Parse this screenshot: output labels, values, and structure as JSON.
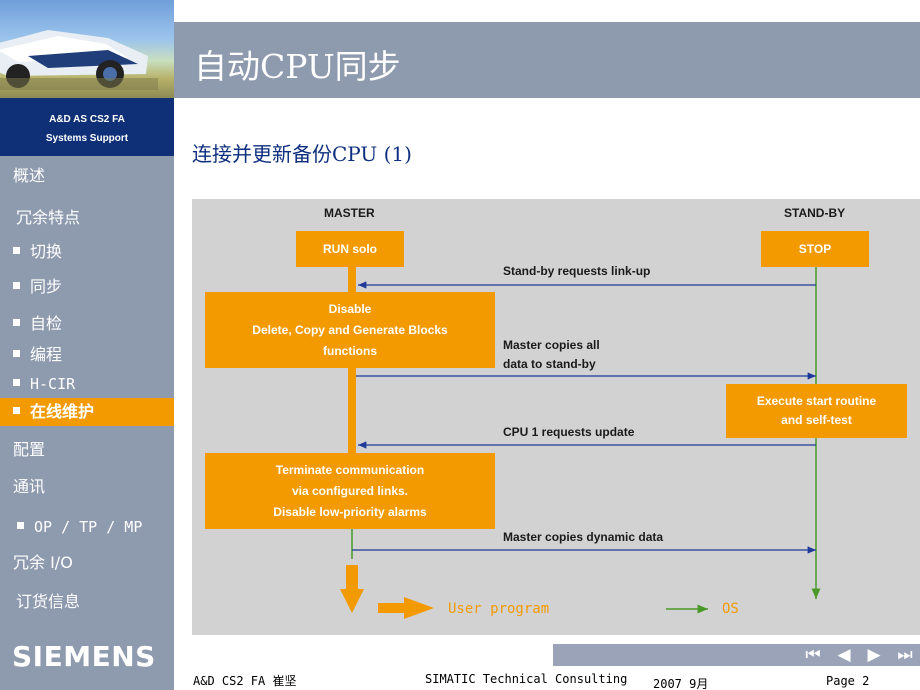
{
  "sidebar": {
    "brand_line1": "A&D AS CS2 FA",
    "brand_line2": "Systems Support",
    "items": [
      {
        "label": "概述"
      },
      {
        "label": "冗余特点"
      },
      {
        "label": "切换"
      },
      {
        "label": "同步"
      },
      {
        "label": "自检"
      },
      {
        "label": "编程"
      },
      {
        "label": "H-CIR"
      },
      {
        "label": "在线维护"
      },
      {
        "label": "配置"
      },
      {
        "label": "通讯"
      },
      {
        "label": "OP / TP / MP"
      },
      {
        "label": "冗余 I/O"
      },
      {
        "label": "订货信息"
      }
    ],
    "logo": "SIEMENS"
  },
  "header": {
    "title": "自动CPU同步",
    "subtitle": "连接并更新备份CPU (1)"
  },
  "diagram": {
    "master_label": "MASTER",
    "standby_label": "STAND-BY",
    "run_solo": "RUN solo",
    "stop": "STOP",
    "msg_linkup": "Stand-by requests link-up",
    "box_disable": [
      "Disable",
      "Delete, Copy and Generate Blocks",
      "functions"
    ],
    "msg_copies_all": [
      "Master copies all",
      "data to stand-by"
    ],
    "box_execute": [
      "Execute start routine",
      "and self-test"
    ],
    "msg_cpu1": "CPU 1 requests update",
    "box_terminate": [
      "Terminate communication",
      "via configured links.",
      "Disable low-priority alarms"
    ],
    "msg_dynamic": "Master copies dynamic data",
    "legend_user": "User program",
    "legend_os": "OS"
  },
  "footer": {
    "left": "A&D CS2  FA  崔坚",
    "center": "SIMATIC Technical Consulting",
    "date": "2007 9月",
    "page": "Page 2"
  },
  "colors": {
    "sidebar": "#8e9aae",
    "brand_bg": "#0f3077",
    "accent_orange": "#f39a00",
    "subtitle_blue": "#0e2f7f",
    "diagram_bg": "#d2d2d2",
    "arrow_blue": "#1f3a9a",
    "os_green": "#4a9a2a"
  },
  "icons": [
    "first-page-icon",
    "prev-page-icon",
    "next-page-icon",
    "last-page-icon"
  ]
}
